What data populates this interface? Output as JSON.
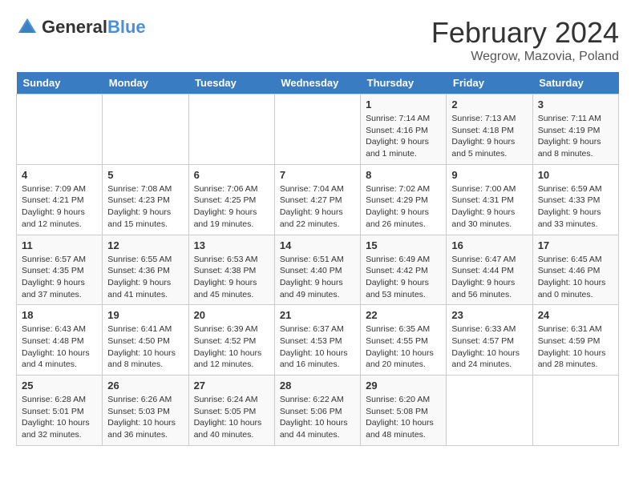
{
  "header": {
    "logo_general": "General",
    "logo_blue": "Blue",
    "month_title": "February 2024",
    "location": "Wegrow, Mazovia, Poland"
  },
  "days_of_week": [
    "Sunday",
    "Monday",
    "Tuesday",
    "Wednesday",
    "Thursday",
    "Friday",
    "Saturday"
  ],
  "weeks": [
    [
      {
        "day": "",
        "info": ""
      },
      {
        "day": "",
        "info": ""
      },
      {
        "day": "",
        "info": ""
      },
      {
        "day": "",
        "info": ""
      },
      {
        "day": "1",
        "info": "Sunrise: 7:14 AM\nSunset: 4:16 PM\nDaylight: 9 hours\nand 1 minute."
      },
      {
        "day": "2",
        "info": "Sunrise: 7:13 AM\nSunset: 4:18 PM\nDaylight: 9 hours\nand 5 minutes."
      },
      {
        "day": "3",
        "info": "Sunrise: 7:11 AM\nSunset: 4:19 PM\nDaylight: 9 hours\nand 8 minutes."
      }
    ],
    [
      {
        "day": "4",
        "info": "Sunrise: 7:09 AM\nSunset: 4:21 PM\nDaylight: 9 hours\nand 12 minutes."
      },
      {
        "day": "5",
        "info": "Sunrise: 7:08 AM\nSunset: 4:23 PM\nDaylight: 9 hours\nand 15 minutes."
      },
      {
        "day": "6",
        "info": "Sunrise: 7:06 AM\nSunset: 4:25 PM\nDaylight: 9 hours\nand 19 minutes."
      },
      {
        "day": "7",
        "info": "Sunrise: 7:04 AM\nSunset: 4:27 PM\nDaylight: 9 hours\nand 22 minutes."
      },
      {
        "day": "8",
        "info": "Sunrise: 7:02 AM\nSunset: 4:29 PM\nDaylight: 9 hours\nand 26 minutes."
      },
      {
        "day": "9",
        "info": "Sunrise: 7:00 AM\nSunset: 4:31 PM\nDaylight: 9 hours\nand 30 minutes."
      },
      {
        "day": "10",
        "info": "Sunrise: 6:59 AM\nSunset: 4:33 PM\nDaylight: 9 hours\nand 33 minutes."
      }
    ],
    [
      {
        "day": "11",
        "info": "Sunrise: 6:57 AM\nSunset: 4:35 PM\nDaylight: 9 hours\nand 37 minutes."
      },
      {
        "day": "12",
        "info": "Sunrise: 6:55 AM\nSunset: 4:36 PM\nDaylight: 9 hours\nand 41 minutes."
      },
      {
        "day": "13",
        "info": "Sunrise: 6:53 AM\nSunset: 4:38 PM\nDaylight: 9 hours\nand 45 minutes."
      },
      {
        "day": "14",
        "info": "Sunrise: 6:51 AM\nSunset: 4:40 PM\nDaylight: 9 hours\nand 49 minutes."
      },
      {
        "day": "15",
        "info": "Sunrise: 6:49 AM\nSunset: 4:42 PM\nDaylight: 9 hours\nand 53 minutes."
      },
      {
        "day": "16",
        "info": "Sunrise: 6:47 AM\nSunset: 4:44 PM\nDaylight: 9 hours\nand 56 minutes."
      },
      {
        "day": "17",
        "info": "Sunrise: 6:45 AM\nSunset: 4:46 PM\nDaylight: 10 hours\nand 0 minutes."
      }
    ],
    [
      {
        "day": "18",
        "info": "Sunrise: 6:43 AM\nSunset: 4:48 PM\nDaylight: 10 hours\nand 4 minutes."
      },
      {
        "day": "19",
        "info": "Sunrise: 6:41 AM\nSunset: 4:50 PM\nDaylight: 10 hours\nand 8 minutes."
      },
      {
        "day": "20",
        "info": "Sunrise: 6:39 AM\nSunset: 4:52 PM\nDaylight: 10 hours\nand 12 minutes."
      },
      {
        "day": "21",
        "info": "Sunrise: 6:37 AM\nSunset: 4:53 PM\nDaylight: 10 hours\nand 16 minutes."
      },
      {
        "day": "22",
        "info": "Sunrise: 6:35 AM\nSunset: 4:55 PM\nDaylight: 10 hours\nand 20 minutes."
      },
      {
        "day": "23",
        "info": "Sunrise: 6:33 AM\nSunset: 4:57 PM\nDaylight: 10 hours\nand 24 minutes."
      },
      {
        "day": "24",
        "info": "Sunrise: 6:31 AM\nSunset: 4:59 PM\nDaylight: 10 hours\nand 28 minutes."
      }
    ],
    [
      {
        "day": "25",
        "info": "Sunrise: 6:28 AM\nSunset: 5:01 PM\nDaylight: 10 hours\nand 32 minutes."
      },
      {
        "day": "26",
        "info": "Sunrise: 6:26 AM\nSunset: 5:03 PM\nDaylight: 10 hours\nand 36 minutes."
      },
      {
        "day": "27",
        "info": "Sunrise: 6:24 AM\nSunset: 5:05 PM\nDaylight: 10 hours\nand 40 minutes."
      },
      {
        "day": "28",
        "info": "Sunrise: 6:22 AM\nSunset: 5:06 PM\nDaylight: 10 hours\nand 44 minutes."
      },
      {
        "day": "29",
        "info": "Sunrise: 6:20 AM\nSunset: 5:08 PM\nDaylight: 10 hours\nand 48 minutes."
      },
      {
        "day": "",
        "info": ""
      },
      {
        "day": "",
        "info": ""
      }
    ]
  ]
}
